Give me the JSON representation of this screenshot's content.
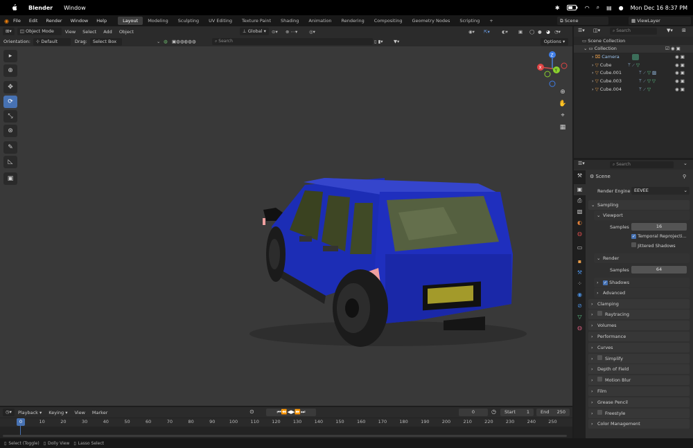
{
  "mac_menubar": {
    "apple_label": "",
    "app_name": "Blender",
    "menu_window": "Window",
    "datetime": "Mon Dec 16  8:37 PM"
  },
  "top_menu": {
    "items": [
      "File",
      "Edit",
      "Render",
      "Window",
      "Help"
    ],
    "workspaces": [
      "Layout",
      "Modeling",
      "Sculpting",
      "UV Editing",
      "Texture Paint",
      "Shading",
      "Animation",
      "Rendering",
      "Compositing",
      "Geometry Nodes",
      "Scripting"
    ],
    "add_tab": "+",
    "scene": "Scene",
    "view_layer": "ViewLayer"
  },
  "viewport_header": {
    "mode": "Object Mode",
    "menus": [
      "View",
      "Select",
      "Add",
      "Object"
    ],
    "transform_orientation": "Global"
  },
  "tool_settings": {
    "orientation_label": "Orientation:",
    "orientation_value": "Default",
    "drag_label": "Drag:",
    "drag_value": "Select Box",
    "search_placeholder": "Search",
    "options": "Options"
  },
  "outliner": {
    "search_placeholder": "Search",
    "scene_collection": "Scene Collection",
    "collection": "Collection",
    "objects": [
      "Camera",
      "Cube",
      "Cube.001",
      "Cube.003",
      "Cube.004"
    ]
  },
  "properties": {
    "search_placeholder": "Search",
    "scene": "Scene",
    "render_engine_label": "Render Engine",
    "render_engine": "EEVEE",
    "sampling": "Sampling",
    "viewport": "Viewport",
    "samples_label": "Samples",
    "viewport_samples": "16",
    "temporal": "Temporal Reprojecti...",
    "jittered": "Jittered Shadows",
    "render": "Render",
    "render_samples": "64",
    "shadows": "Shadows",
    "advanced": "Advanced",
    "sections": [
      "Clamping",
      "Raytracing",
      "Volumes",
      "Performance",
      "Curves",
      "Simplify",
      "Depth of Field",
      "Motion Blur",
      "Film",
      "Grease Pencil",
      "Freestyle",
      "Color Management"
    ]
  },
  "timeline": {
    "menus": [
      "Playback",
      "Keying",
      "View",
      "Marker"
    ],
    "current_frame": "0",
    "start_label": "Start",
    "start": "1",
    "end_label": "End",
    "end": "250",
    "ticks": [
      "0",
      "10",
      "20",
      "30",
      "40",
      "50",
      "60",
      "70",
      "80",
      "90",
      "100",
      "110",
      "120",
      "130",
      "140",
      "150",
      "160",
      "170",
      "180",
      "190",
      "200",
      "210",
      "220",
      "230",
      "240",
      "250"
    ]
  },
  "statusbar": {
    "select": "Select (Toggle)",
    "dolly": "Dolly View",
    "lasso": "Lasso Select"
  },
  "colors": {
    "accent": "#4772b3",
    "car_body": "#1a2cb0"
  }
}
